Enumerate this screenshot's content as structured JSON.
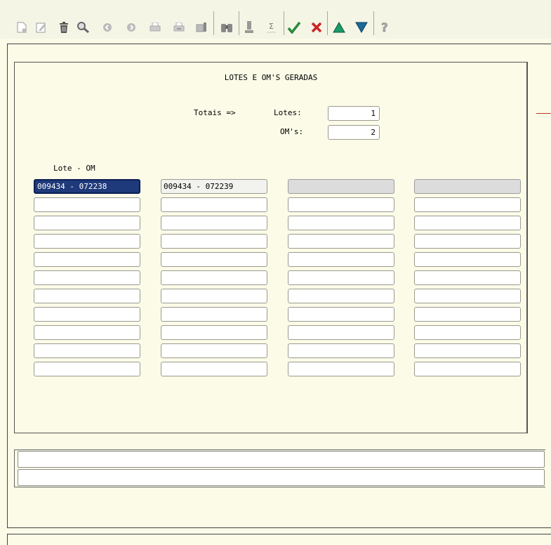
{
  "toolbar": {
    "buttons": [
      {
        "name": "new-record-icon"
      },
      {
        "name": "edit-record-icon"
      },
      {
        "name": "delete-record-icon"
      },
      {
        "name": "search-icon"
      },
      {
        "name": "previous-icon"
      },
      {
        "name": "next-icon"
      },
      {
        "name": "print-icon"
      },
      {
        "name": "print-setup-icon"
      },
      {
        "name": "export-icon"
      },
      {
        "name": "binoculars-icon"
      },
      {
        "name": "filter-icon"
      },
      {
        "name": "sum-icon"
      },
      {
        "name": "confirm-check-icon"
      },
      {
        "name": "cancel-x-icon"
      },
      {
        "name": "move-up-icon"
      },
      {
        "name": "move-down-icon"
      },
      {
        "name": "help-icon"
      }
    ],
    "colors": {
      "check": "#2a8a3a",
      "cancel": "#cc2222",
      "up": "#1a9a6a",
      "down": "#1a6a9a"
    }
  },
  "title": "LOTES E OM'S GERADAS",
  "totals": {
    "caption": "Totais =>",
    "lotes_label": "Lotes:",
    "lotes_value": "1",
    "oms_label": "OM's:",
    "oms_value": "2"
  },
  "grid": {
    "column_header": "Lote - OM",
    "columns": [
      [
        "009434 - 072238",
        "",
        "",
        "",
        "",
        "",
        "",
        "",
        "",
        "",
        "",
        ""
      ],
      [
        "009434 - 072239",
        "",
        "",
        "",
        "",
        "",
        "",
        "",
        "",
        "",
        "",
        ""
      ],
      [
        "",
        "",
        "",
        "",
        "",
        "",
        "",
        "",
        "",
        "",
        "",
        ""
      ],
      [
        "",
        "",
        "",
        "",
        "",
        "",
        "",
        "",
        "",
        "",
        "",
        ""
      ]
    ],
    "selected": {
      "col": 0,
      "row": 0
    }
  },
  "status": {
    "line1": "",
    "line2": ""
  },
  "colors": {
    "background": "#fbfbe8",
    "selection": "#1f3a7a",
    "accent_red": "#c0392b"
  }
}
